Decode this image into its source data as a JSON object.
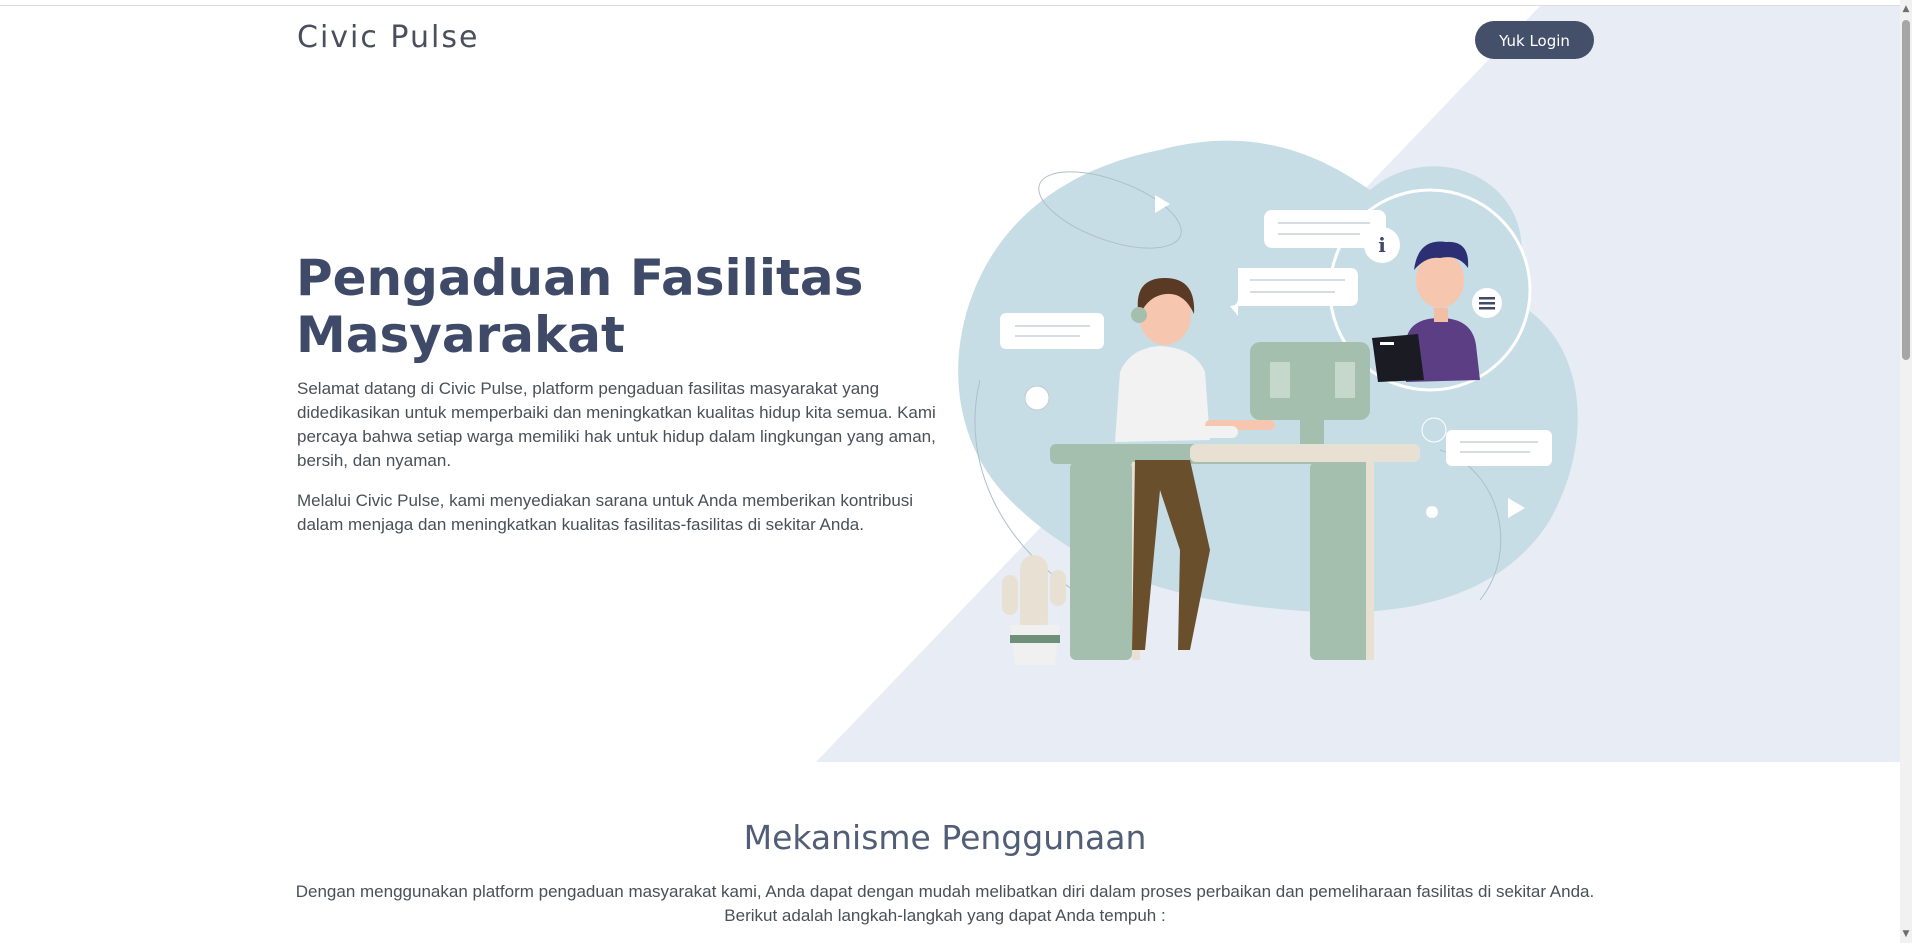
{
  "header": {
    "brand": "Civic Pulse",
    "login_label": "Yuk Login"
  },
  "hero": {
    "title": "Pengaduan Fasilitas Masyarakat",
    "paragraph1": "Selamat datang di Civic Pulse, platform pengaduan fasilitas masyarakat yang didedikasikan untuk memperbaiki dan meningkatkan kualitas hidup kita semua. Kami percaya bahwa setiap warga memiliki hak untuk hidup dalam lingkungan yang aman, bersih, dan nyaman.",
    "paragraph2": "Melalui Civic Pulse, kami menyediakan sarana untuk Anda memberikan kontribusi dalam menjaga dan meningkatkan kualitas fasilitas-fasilitas di sekitar Anda."
  },
  "illustration": {
    "info_glyph": "i"
  },
  "mechanism": {
    "title": "Mekanisme Penggunaan",
    "description": "Dengan menggunakan platform pengaduan masyarakat kami, Anda dapat dengan mudah melibatkan diri dalam proses perbaikan dan pemeliharaan fasilitas di sekitar Anda. Berikut adalah langkah-langkah yang dapat Anda tempuh :"
  },
  "colors": {
    "accent": "#444f69",
    "hero_bg": "#e7ecf5",
    "blob": "#c7dde6",
    "title": "#3e4a68"
  },
  "icons": {
    "scroll_up": "scroll-up-arrow-icon",
    "scroll_down": "scroll-down-arrow-icon"
  }
}
